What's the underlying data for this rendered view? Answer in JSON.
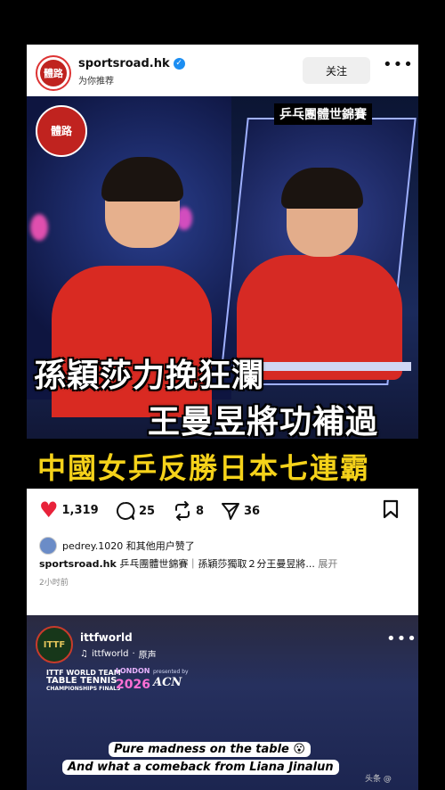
{
  "post1": {
    "username": "sportsroad.hk",
    "subtitle": "为你推荐",
    "follow_label": "关注",
    "more_label": "•••",
    "avatar_text": "體路",
    "image": {
      "logo_text": "體路",
      "tag": "乒乓團體世錦賽",
      "caption_line1": "孫穎莎力挽狂瀾",
      "caption_line2": "王曼昱將功補過",
      "caption_line3": "中國女乒反勝日本七連霸"
    },
    "actions": {
      "likes": "1,319",
      "comments": "25",
      "reposts": "8",
      "shares": "36"
    },
    "liked_by": "pedrey.1020 和其他用户赞了",
    "caption_user": "sportsroad.hk",
    "caption_text": " 乒乓團體世錦賽｜孫穎莎獨取２分王曼昱將...",
    "caption_more": "展开",
    "time": "2小时前"
  },
  "post2": {
    "username": "ittfworld",
    "audio_user": "ittfworld",
    "audio_label": "原声",
    "more_label": "•••",
    "avatar_text": "ITTF",
    "event_text": "ITTF WORLD TEAM",
    "event_text2": "TABLE TENNIS",
    "event_text3": "CHAMPIONSHIPS FINALS",
    "london": "LONDON",
    "year": "2026",
    "sponsor_label": "presented by",
    "sponsor": "ACN",
    "subtitle1": "Pure madness on the table 😮",
    "subtitle2": "And what a comeback from Liana Jinalun",
    "watermark": "头条 @"
  },
  "colors": {
    "like_red": "#e8223a",
    "verified_blue": "#1c8ef2",
    "caption_yellow": "#f5d21a"
  }
}
